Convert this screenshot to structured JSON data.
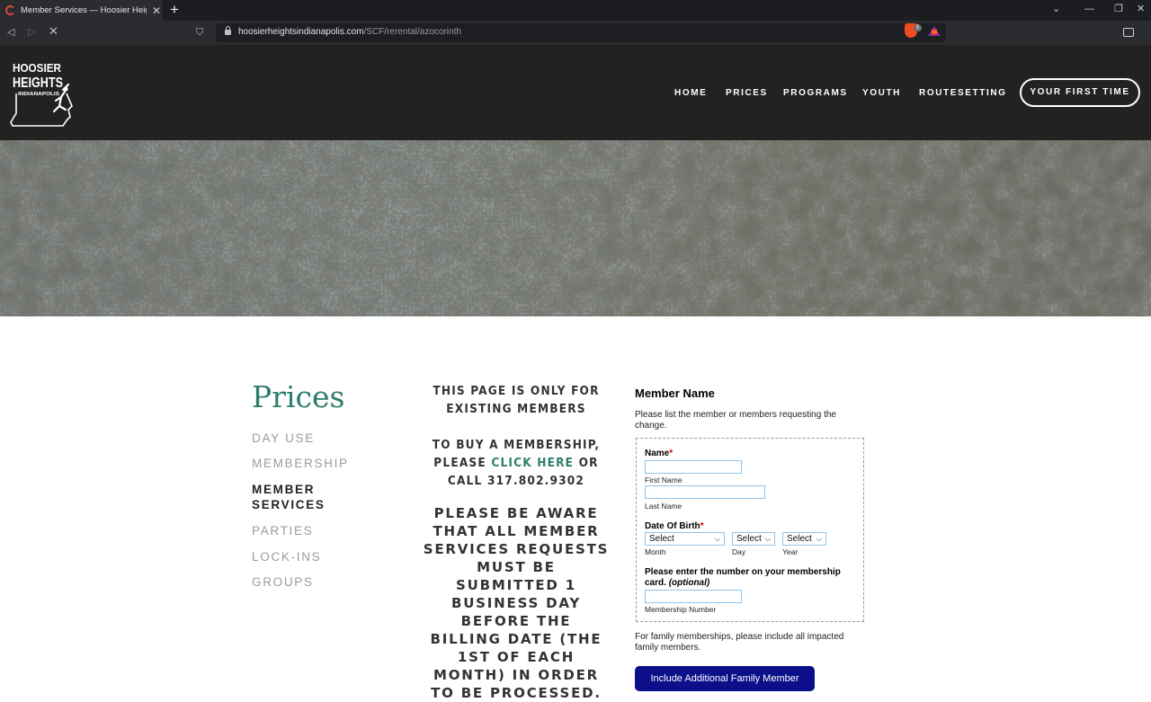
{
  "browser": {
    "tab_title": "Member Services — Hoosier Heights",
    "new_tab_label": "+",
    "url_domain": "hoosierheightsindianapolis.com",
    "url_path": "/SCF/rerental/azocorinth",
    "brave_count": "5"
  },
  "header": {
    "logo_text_1": "HOOSIER",
    "logo_text_2": "HEIGHTS",
    "logo_text_3": "INDIANAPOLIS",
    "nav": [
      "HOME",
      "PRICES",
      "PROGRAMS",
      "YOUTH",
      "ROUTESETTING"
    ],
    "cta_label": "YOUR FIRST TIME"
  },
  "sidebar": {
    "title": "Prices",
    "items": [
      "DAY USE",
      "MEMBERSHIP",
      "MEMBER SERVICES",
      "PARTIES",
      "LOCK-INS",
      "GROUPS"
    ],
    "active_index": 2
  },
  "notice": {
    "line1": "THIS PAGE IS ONLY FOR EXISTING MEMBERS",
    "line2_pre": "TO BUY A MEMBERSHIP, PLEASE",
    "line2_link": "CLICK HERE",
    "line2_post": "OR CALL",
    "phone": "317.802.9302",
    "line3": "PLEASE BE AWARE THAT ALL MEMBER SERVICES REQUESTS MUST BE SUBMITTED 1 BUSINESS DAY BEFORE THE BILLING DATE (THE 1ST OF EACH MONTH) IN ORDER TO BE PROCESSED."
  },
  "form": {
    "title": "Member Name",
    "description": "Please list the member or members requesting the change.",
    "name_label": "Name",
    "required_mark": "*",
    "first_name_value": "",
    "first_name_sub": "First Name",
    "last_name_value": "",
    "last_name_sub": "Last Name",
    "dob_label": "Date Of Birth",
    "month_value": "Select",
    "month_sub": "Month",
    "day_value": "Select",
    "day_sub": "Day",
    "year_value": "Select",
    "year_sub": "Year",
    "card_label": "Please enter the number on your membership card.",
    "card_optional": "(optional)",
    "membership_value": "",
    "membership_sub": "Membership Number",
    "family_note": "For family memberships, please include all impacted family members.",
    "add_family_button": "Include Additional Family Member"
  },
  "colors": {
    "header_bg": "#222222",
    "accent_green": "#2e7d6a",
    "button_blue": "#0b0f8a"
  }
}
